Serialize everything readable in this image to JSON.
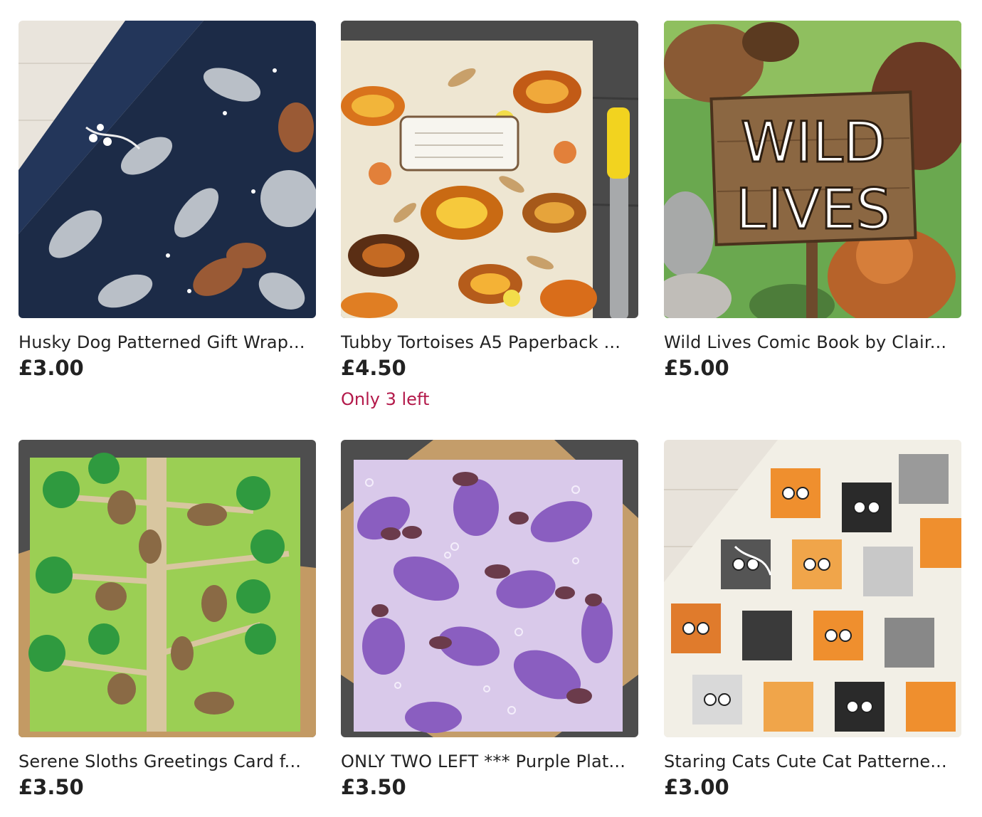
{
  "listings": [
    {
      "title": "Husky Dog Patterned Gift Wrap...",
      "price": "£3.00",
      "stock": ""
    },
    {
      "title": "Tubby Tortoises A5 Paperback ...",
      "price": "£4.50",
      "stock": "Only 3 left"
    },
    {
      "title": "Wild Lives Comic Book by Clair...",
      "price": "£5.00",
      "stock": ""
    },
    {
      "title": "Serene Sloths Greetings Card f...",
      "price": "£3.50",
      "stock": ""
    },
    {
      "title": "ONLY TWO LEFT *** Purple Plat...",
      "price": "£3.50",
      "stock": ""
    },
    {
      "title": "Staring Cats Cute Cat Patterne...",
      "price": "£3.00",
      "stock": ""
    }
  ],
  "comic_sign": {
    "line1": "WILD",
    "line2": "LIVES"
  },
  "colors": {
    "stock_text": "#b3194a",
    "text": "#222222"
  }
}
